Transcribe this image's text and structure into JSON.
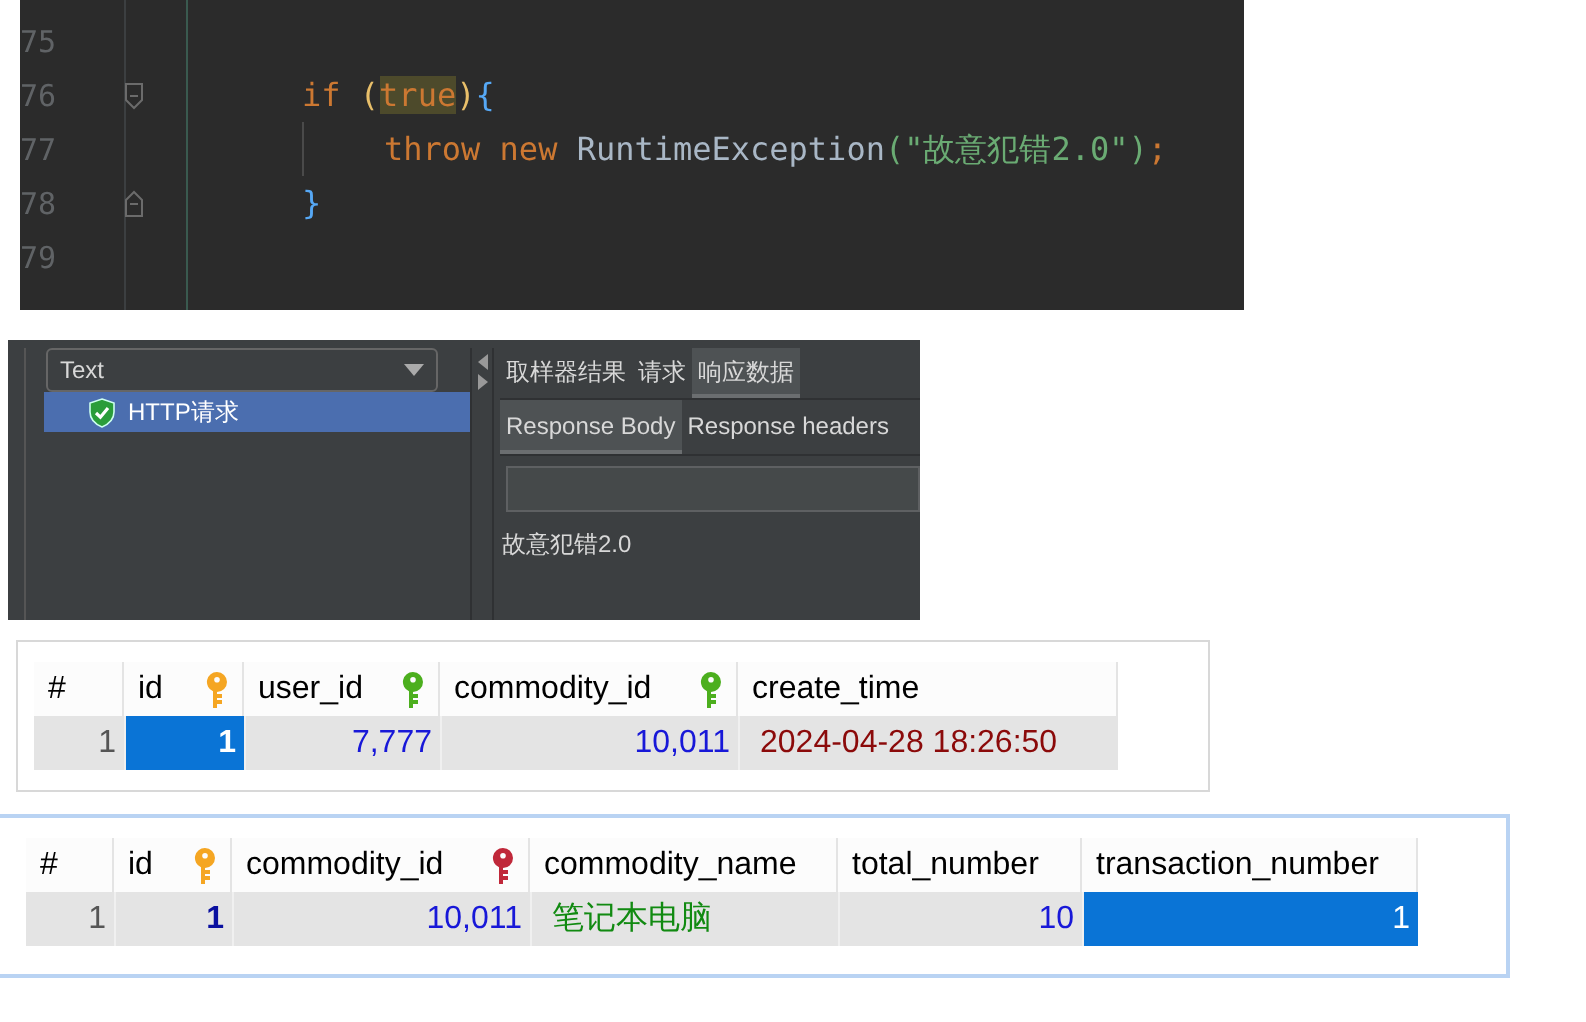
{
  "code_editor": {
    "lines": [
      {
        "number": "75",
        "kind": "plain"
      },
      {
        "number": "76",
        "kind": "fold_start",
        "tokens": [
          {
            "kind": "keyword",
            "text": "if "
          },
          {
            "kind": "paren",
            "text": "("
          },
          {
            "kind": "highlight",
            "text": "true"
          },
          {
            "kind": "paren",
            "text": ")"
          },
          {
            "kind": "brace",
            "text": "{"
          }
        ],
        "children": [
          {
            "number": "77",
            "tokens": [
              {
                "kind": "keyword",
                "text": "throw new "
              },
              {
                "kind": "plain",
                "text": "RuntimeException"
              },
              {
                "kind": "string",
                "text": "(\"故意犯错2.0\")"
              },
              {
                "kind": "keyword",
                "text": ";"
              }
            ]
          }
        ]
      },
      {
        "number": "78",
        "kind": "fold_end",
        "tokens": [
          {
            "kind": "brace",
            "text": "}"
          }
        ]
      },
      {
        "number": "79",
        "kind": "plain"
      }
    ]
  },
  "results_tree": {
    "dropdown": {
      "value": "Text"
    },
    "items": [
      {
        "label": "HTTP请求",
        "kind": "success",
        "selected": true
      }
    ],
    "tabs": [
      {
        "label": "取样器结果",
        "selected": false
      },
      {
        "label": "请求",
        "selected": false
      },
      {
        "label": "响应数据",
        "selected": true
      }
    ],
    "sub_tabs": [
      {
        "label": "Response Body",
        "selected": true
      },
      {
        "label": "Response headers",
        "selected": false
      }
    ],
    "response_text": "故意犯错2.0"
  },
  "tables": [
    {
      "columns": [
        {
          "label": "#"
        },
        {
          "label": "id",
          "key": {
            "color": "#f5a623"
          }
        },
        {
          "label": "user_id",
          "key": {
            "color": "#4caf1e"
          }
        },
        {
          "label": "commodity_id",
          "key": {
            "color": "#4caf1e"
          }
        },
        {
          "label": "create_time"
        }
      ],
      "rows": [
        {
          "cells": [
            {
              "text": "1",
              "kind": "row_number",
              "selected": false
            },
            {
              "text": "1",
              "kind": "primary",
              "selected": true
            },
            {
              "text": "7,777",
              "kind": "number",
              "selected": false
            },
            {
              "text": "10,011",
              "kind": "number",
              "selected": false
            },
            {
              "text": "2024-04-28 18:26:50",
              "kind": "datetime",
              "selected": false
            }
          ]
        }
      ]
    },
    {
      "columns": [
        {
          "label": "#"
        },
        {
          "label": "id",
          "key": {
            "color": "#f5a623"
          }
        },
        {
          "label": "commodity_id",
          "key": {
            "color": "#c0283a"
          }
        },
        {
          "label": "commodity_name"
        },
        {
          "label": "total_number"
        },
        {
          "label": "transaction_number"
        }
      ],
      "rows": [
        {
          "cells": [
            {
              "text": "1",
              "kind": "row_number",
              "selected": false
            },
            {
              "text": "1",
              "kind": "primary",
              "selected": false
            },
            {
              "text": "10,011",
              "kind": "number",
              "selected": false
            },
            {
              "text": "笔记本电脑",
              "kind": "text",
              "selected": false
            },
            {
              "text": "10",
              "kind": "number",
              "selected": false
            },
            {
              "text": "1",
              "kind": "number",
              "selected": true
            }
          ]
        }
      ]
    }
  ]
}
